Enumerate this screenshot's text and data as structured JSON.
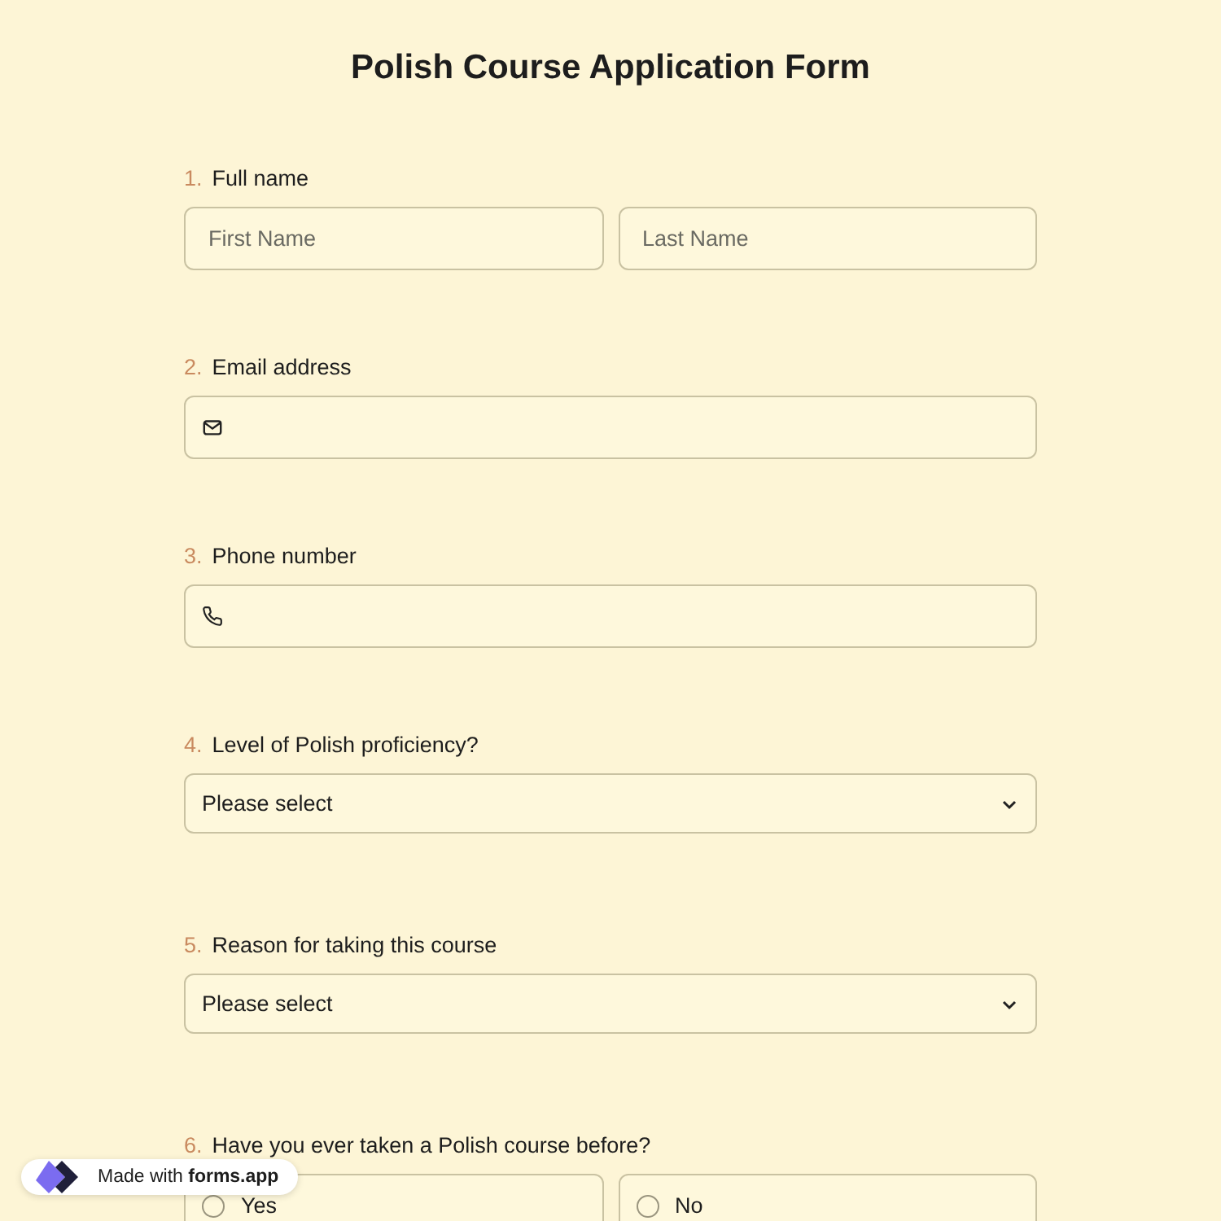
{
  "title": "Polish Course Application Form",
  "questions": [
    {
      "number": "1.",
      "label": "Full name",
      "kind": "name",
      "placeholders": [
        "First Name",
        "Last Name"
      ]
    },
    {
      "number": "2.",
      "label": "Email address",
      "kind": "email"
    },
    {
      "number": "3.",
      "label": "Phone number",
      "kind": "phone"
    },
    {
      "number": "4.",
      "label": "Level of Polish proficiency?",
      "kind": "select",
      "value": "Please select"
    },
    {
      "number": "5.",
      "label": "Reason for taking this course",
      "kind": "select",
      "value": "Please select"
    },
    {
      "number": "6.",
      "label": "Have you ever taken a Polish course before?",
      "kind": "choice",
      "options": [
        {
          "label": "Yes",
          "selected": false
        },
        {
          "label": "No",
          "selected": false
        }
      ]
    }
  ],
  "badge": {
    "prefix": "Made with",
    "brand": "forms.app"
  }
}
